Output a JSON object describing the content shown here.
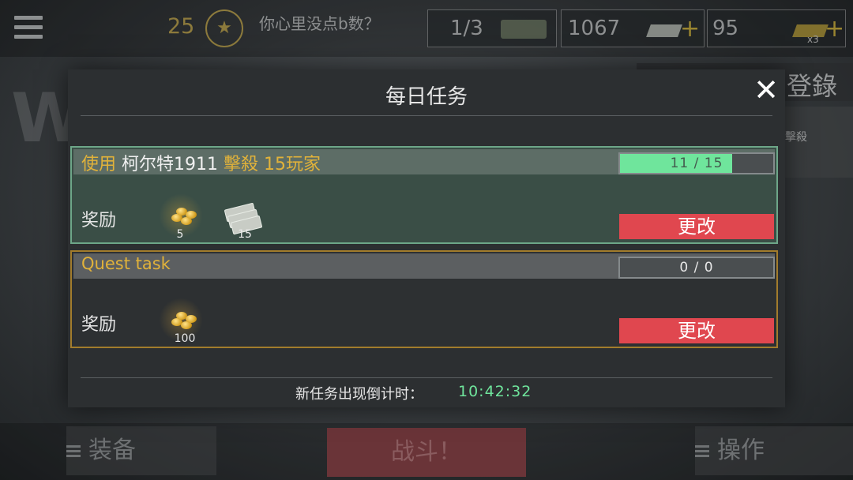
{
  "hud": {
    "level": "25",
    "rank_badge_glyph": "★",
    "player_name": "你心里没点b数？",
    "ammo_count": "1/3",
    "cash_amount": "1067",
    "gold_amount": "95",
    "plus_glyph": "+",
    "gold_multiplier": "x3"
  },
  "background": {
    "big_letter": "W",
    "right_title": "登錄",
    "side_panel_text": "擊殺"
  },
  "bottom_nav": {
    "equipment_label": "装备",
    "fight_label": "战斗！",
    "operation_label": "操作"
  },
  "dialog": {
    "title": "每日任务",
    "close_glyph": "✕",
    "quests": [
      {
        "desc_use": "使用",
        "desc_weapon": "柯尔特1911",
        "desc_action": "擊殺",
        "desc_target": "15玩家",
        "progress_text": "11 / 15",
        "progress_value": 11,
        "progress_max": 15,
        "reward_label": "奖励",
        "rewards": [
          {
            "type": "gold-coins",
            "amount": "5"
          },
          {
            "type": "cash",
            "amount": "15"
          }
        ],
        "change_label": "更改"
      },
      {
        "title": "Quest task",
        "progress_text": "0 / 0",
        "progress_value": 0,
        "progress_max": 0,
        "reward_label": "奖励",
        "rewards": [
          {
            "type": "gold-coins",
            "amount": "100"
          }
        ],
        "change_label": "更改"
      }
    ],
    "timer_label": "新任务出现倒计时：",
    "timer_value": "10:42:32"
  },
  "colors": {
    "progress_fill": "#6fe59c",
    "change_button": "#e0474f",
    "highlight_text": "#e1b23a",
    "quest1_border": "#6da688",
    "quest2_border": "#a27c2c"
  }
}
